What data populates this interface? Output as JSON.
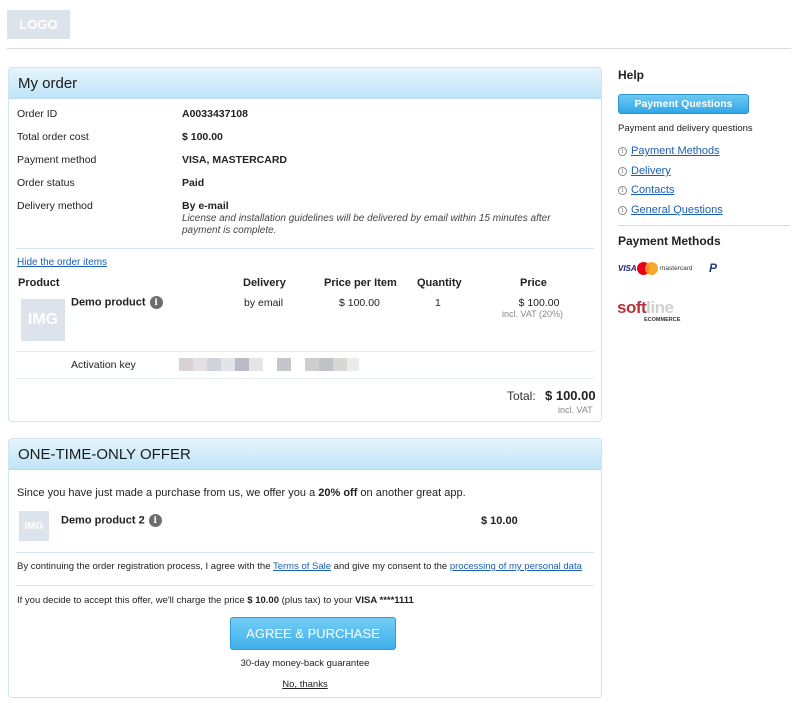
{
  "header": {
    "logo": "LOGO"
  },
  "order": {
    "title": "My order",
    "fields": [
      {
        "label": "Order ID",
        "value": "A0033437108"
      },
      {
        "label": "Total order cost",
        "value": "$ 100.00"
      },
      {
        "label": "Payment method",
        "value": "VISA, MASTERCARD"
      },
      {
        "label": "Order status",
        "value": "Paid"
      },
      {
        "label": "Delivery method",
        "value": "By e-mail"
      }
    ],
    "delivery_note": "License and installation guidelines will be delivered by email within 15 minutes after payment is complete.",
    "hide_items_link": "Hide the order items",
    "table": {
      "headers": [
        "Product",
        "Delivery",
        "Price per Item",
        "Quantity",
        "Price"
      ],
      "item": {
        "img": "IMG",
        "name": "Demo product",
        "delivery": "by email",
        "price_per_item": "$ 100.00",
        "quantity": "1",
        "price": "$ 100.00",
        "vat_note": "incl. VAT (20%)"
      },
      "activation_label": "Activation key"
    },
    "total_label": "Total:",
    "total_value": "$ 100.00",
    "total_note": "incl. VAT"
  },
  "offer": {
    "title": "ONE-TIME-ONLY OFFER",
    "intro_prefix": "Since you have just made a purchase from us, we offer you a ",
    "intro_bold": "20% off",
    "intro_suffix": " on another great app.",
    "product": {
      "img": "IMG",
      "name": "Demo product 2",
      "price": "$ 10.00"
    },
    "consent_prefix": "By continuing the order registration process, I agree with the ",
    "terms_link": "Terms of Sale",
    "consent_middle": " and give my consent to the ",
    "privacy_link": "processing of my personal data",
    "charge_prefix": "If you decide to accept this offer, we'll charge the price ",
    "charge_price": "$ 10.00",
    "charge_middle": " (plus tax) to your ",
    "charge_card": "VISA ****1111",
    "agree_button": "AGREE & PURCHASE",
    "guarantee": "30-day money-back guarantee",
    "no_thanks": "No, thanks"
  },
  "sidebar": {
    "help_title": "Help",
    "payment_questions_button": "Payment Questions",
    "help_subtitle": "Payment and delivery questions",
    "links": [
      "Payment Methods",
      "Delivery",
      "Contacts",
      "General Questions"
    ],
    "payment_methods_title": "Payment Methods",
    "visa": "VISA",
    "mastercard": "mastercard",
    "paypal": "P",
    "softline_soft": "soft",
    "softline_line": "line",
    "softline_sub": "ECOMMERCE"
  },
  "colors": {
    "accent": "#3fb0ea",
    "link": "#1a5fb4",
    "header_gradient_top": "#e6f5fd",
    "header_gradient_bottom": "#bfe4f8"
  }
}
